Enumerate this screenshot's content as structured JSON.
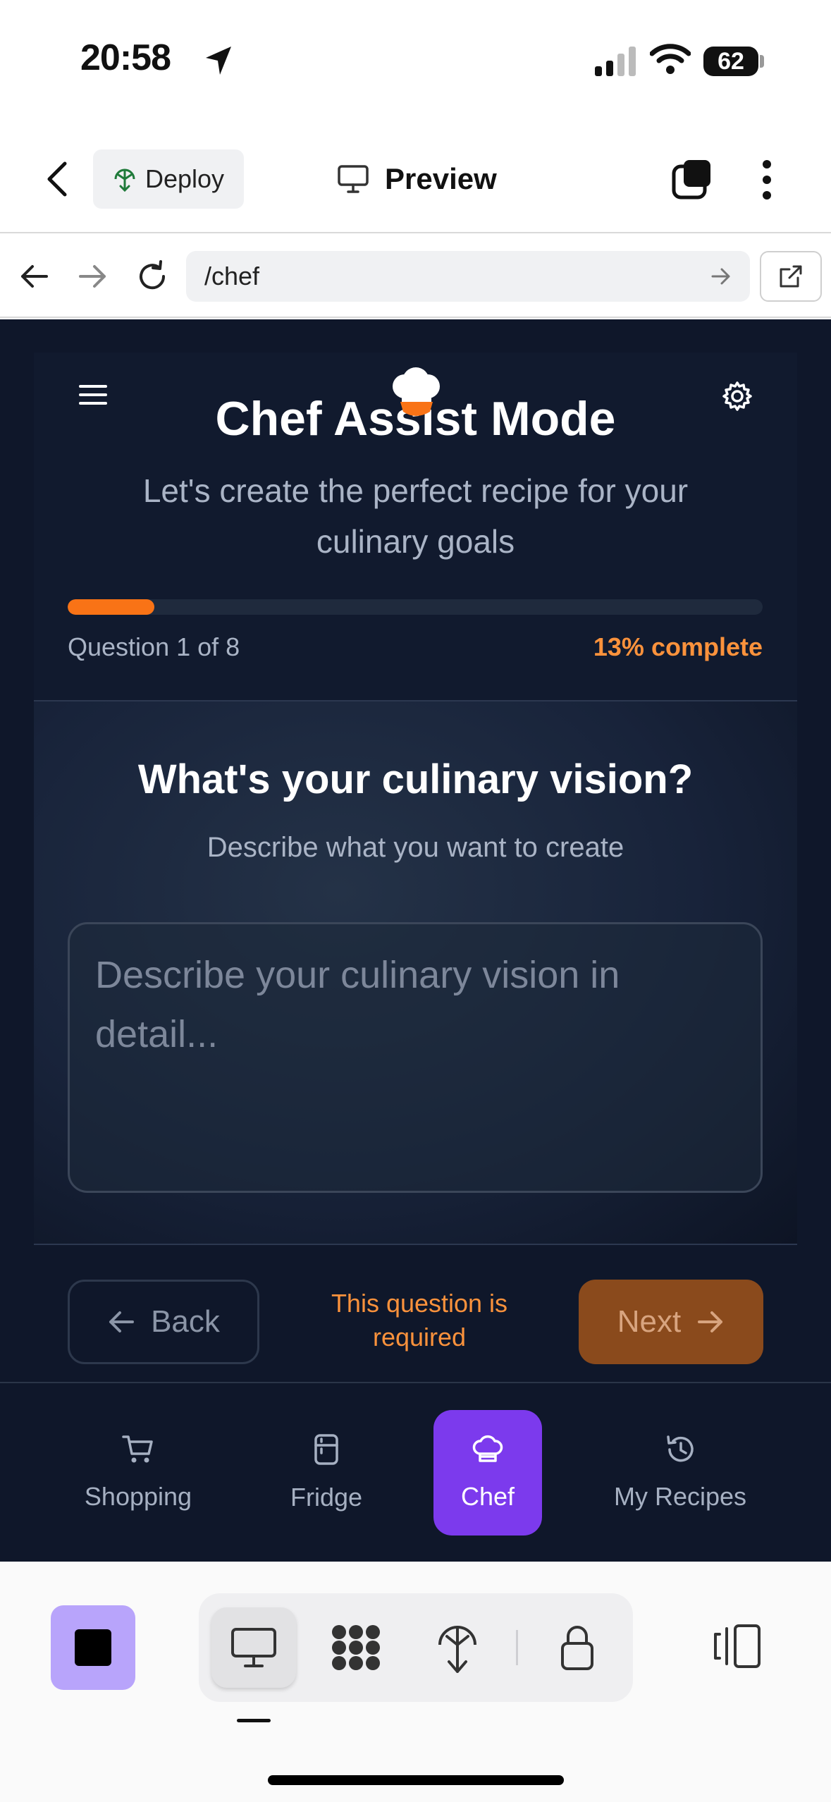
{
  "status_bar": {
    "time": "20:58",
    "battery": "62"
  },
  "app_header": {
    "deploy_label": "Deploy",
    "preview_label": "Preview"
  },
  "browser": {
    "url": "/chef"
  },
  "chef_page": {
    "title": "Chef Assist Mode",
    "subtitle": "Let's create the perfect recipe for your culinary goals",
    "progress": {
      "question_label": "Question 1 of 8",
      "percent_label": "13% complete",
      "fraction": 0.125
    },
    "question": {
      "title": "What's your culinary vision?",
      "description": "Describe what you want to create",
      "input_placeholder": "Describe your culinary vision in detail..."
    },
    "back_label": "Back",
    "required_message": "This question is required",
    "next_label": "Next"
  },
  "bottom_nav": {
    "items": [
      {
        "label": "Shopping",
        "icon": "cart-icon",
        "active": false
      },
      {
        "label": "Fridge",
        "icon": "fridge-icon",
        "active": false
      },
      {
        "label": "Chef",
        "icon": "chef-hat-icon",
        "active": true
      },
      {
        "label": "My Recipes",
        "icon": "history-icon",
        "active": false
      }
    ]
  },
  "colors": {
    "accent_orange": "#f97316",
    "active_nav_purple": "#7c3aed",
    "app_background": "#0f172a"
  }
}
